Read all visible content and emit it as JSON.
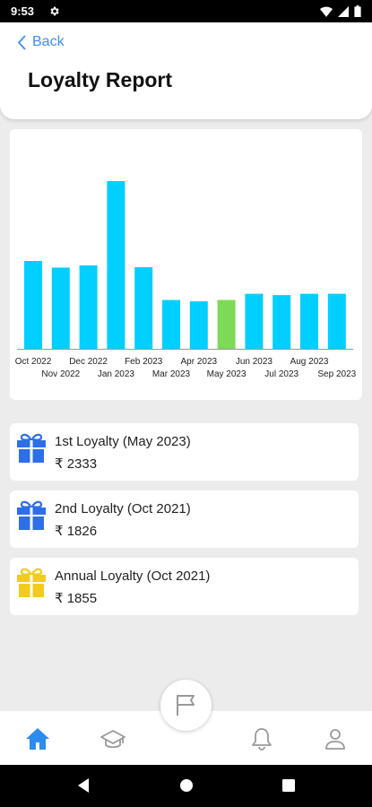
{
  "status_bar": {
    "time": "9:53"
  },
  "header": {
    "back_label": "Back",
    "title": "Loyalty Report"
  },
  "chart_data": {
    "type": "bar",
    "categories": [
      "Oct 2022",
      "Nov 2022",
      "Dec 2022",
      "Jan 2023",
      "Feb 2023",
      "Mar 2023",
      "Apr 2023",
      "May 2023",
      "Jun 2023",
      "Jul 2023",
      "Aug 2023",
      "Sep 2023"
    ],
    "values": [
      1980,
      1830,
      1880,
      3780,
      1840,
      1100,
      1070,
      1100,
      1240,
      1210,
      1240,
      1240
    ],
    "highlighted_category": "May 2023",
    "colors": {
      "bar": "#00cfff",
      "highlight": "#7ed957",
      "axis": "#999999"
    },
    "title": "",
    "xlabel": "",
    "ylabel": ""
  },
  "loyalty_items": [
    {
      "name": "1st Loyalty (May 2023)",
      "amount": "₹ 2333",
      "icon": "gift-icon",
      "color": "#2d6fe8"
    },
    {
      "name": "2nd Loyalty (Oct 2021)",
      "amount": "₹ 1826",
      "icon": "gift-icon",
      "color": "#2d6fe8"
    },
    {
      "name": "Annual Loyalty (Oct 2021)",
      "amount": "₹ 1855",
      "icon": "gift-icon",
      "color": "#f2cb1d"
    }
  ],
  "bottom_nav": {
    "items": [
      {
        "icon": "home-icon",
        "active": true
      },
      {
        "icon": "graduation-cap-icon",
        "active": false
      },
      {
        "icon": "flag-icon",
        "active": false
      },
      {
        "icon": "bell-icon",
        "active": false
      },
      {
        "icon": "user-icon",
        "active": false
      }
    ],
    "active_color": "#2d8cf0",
    "inactive_color": "#999999"
  }
}
